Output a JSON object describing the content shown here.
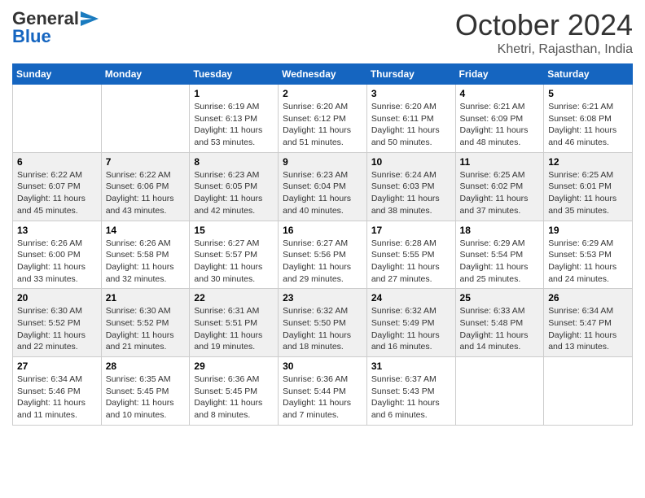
{
  "header": {
    "logo_general": "General",
    "logo_blue": "Blue",
    "month_title": "October 2024",
    "location": "Khetri, Rajasthan, India"
  },
  "weekdays": [
    "Sunday",
    "Monday",
    "Tuesday",
    "Wednesday",
    "Thursday",
    "Friday",
    "Saturday"
  ],
  "weeks": [
    [
      {
        "day": "",
        "info": ""
      },
      {
        "day": "",
        "info": ""
      },
      {
        "day": "1",
        "info": "Sunrise: 6:19 AM\nSunset: 6:13 PM\nDaylight: 11 hours and 53 minutes."
      },
      {
        "day": "2",
        "info": "Sunrise: 6:20 AM\nSunset: 6:12 PM\nDaylight: 11 hours and 51 minutes."
      },
      {
        "day": "3",
        "info": "Sunrise: 6:20 AM\nSunset: 6:11 PM\nDaylight: 11 hours and 50 minutes."
      },
      {
        "day": "4",
        "info": "Sunrise: 6:21 AM\nSunset: 6:09 PM\nDaylight: 11 hours and 48 minutes."
      },
      {
        "day": "5",
        "info": "Sunrise: 6:21 AM\nSunset: 6:08 PM\nDaylight: 11 hours and 46 minutes."
      }
    ],
    [
      {
        "day": "6",
        "info": "Sunrise: 6:22 AM\nSunset: 6:07 PM\nDaylight: 11 hours and 45 minutes."
      },
      {
        "day": "7",
        "info": "Sunrise: 6:22 AM\nSunset: 6:06 PM\nDaylight: 11 hours and 43 minutes."
      },
      {
        "day": "8",
        "info": "Sunrise: 6:23 AM\nSunset: 6:05 PM\nDaylight: 11 hours and 42 minutes."
      },
      {
        "day": "9",
        "info": "Sunrise: 6:23 AM\nSunset: 6:04 PM\nDaylight: 11 hours and 40 minutes."
      },
      {
        "day": "10",
        "info": "Sunrise: 6:24 AM\nSunset: 6:03 PM\nDaylight: 11 hours and 38 minutes."
      },
      {
        "day": "11",
        "info": "Sunrise: 6:25 AM\nSunset: 6:02 PM\nDaylight: 11 hours and 37 minutes."
      },
      {
        "day": "12",
        "info": "Sunrise: 6:25 AM\nSunset: 6:01 PM\nDaylight: 11 hours and 35 minutes."
      }
    ],
    [
      {
        "day": "13",
        "info": "Sunrise: 6:26 AM\nSunset: 6:00 PM\nDaylight: 11 hours and 33 minutes."
      },
      {
        "day": "14",
        "info": "Sunrise: 6:26 AM\nSunset: 5:58 PM\nDaylight: 11 hours and 32 minutes."
      },
      {
        "day": "15",
        "info": "Sunrise: 6:27 AM\nSunset: 5:57 PM\nDaylight: 11 hours and 30 minutes."
      },
      {
        "day": "16",
        "info": "Sunrise: 6:27 AM\nSunset: 5:56 PM\nDaylight: 11 hours and 29 minutes."
      },
      {
        "day": "17",
        "info": "Sunrise: 6:28 AM\nSunset: 5:55 PM\nDaylight: 11 hours and 27 minutes."
      },
      {
        "day": "18",
        "info": "Sunrise: 6:29 AM\nSunset: 5:54 PM\nDaylight: 11 hours and 25 minutes."
      },
      {
        "day": "19",
        "info": "Sunrise: 6:29 AM\nSunset: 5:53 PM\nDaylight: 11 hours and 24 minutes."
      }
    ],
    [
      {
        "day": "20",
        "info": "Sunrise: 6:30 AM\nSunset: 5:52 PM\nDaylight: 11 hours and 22 minutes."
      },
      {
        "day": "21",
        "info": "Sunrise: 6:30 AM\nSunset: 5:52 PM\nDaylight: 11 hours and 21 minutes."
      },
      {
        "day": "22",
        "info": "Sunrise: 6:31 AM\nSunset: 5:51 PM\nDaylight: 11 hours and 19 minutes."
      },
      {
        "day": "23",
        "info": "Sunrise: 6:32 AM\nSunset: 5:50 PM\nDaylight: 11 hours and 18 minutes."
      },
      {
        "day": "24",
        "info": "Sunrise: 6:32 AM\nSunset: 5:49 PM\nDaylight: 11 hours and 16 minutes."
      },
      {
        "day": "25",
        "info": "Sunrise: 6:33 AM\nSunset: 5:48 PM\nDaylight: 11 hours and 14 minutes."
      },
      {
        "day": "26",
        "info": "Sunrise: 6:34 AM\nSunset: 5:47 PM\nDaylight: 11 hours and 13 minutes."
      }
    ],
    [
      {
        "day": "27",
        "info": "Sunrise: 6:34 AM\nSunset: 5:46 PM\nDaylight: 11 hours and 11 minutes."
      },
      {
        "day": "28",
        "info": "Sunrise: 6:35 AM\nSunset: 5:45 PM\nDaylight: 11 hours and 10 minutes."
      },
      {
        "day": "29",
        "info": "Sunrise: 6:36 AM\nSunset: 5:45 PM\nDaylight: 11 hours and 8 minutes."
      },
      {
        "day": "30",
        "info": "Sunrise: 6:36 AM\nSunset: 5:44 PM\nDaylight: 11 hours and 7 minutes."
      },
      {
        "day": "31",
        "info": "Sunrise: 6:37 AM\nSunset: 5:43 PM\nDaylight: 11 hours and 6 minutes."
      },
      {
        "day": "",
        "info": ""
      },
      {
        "day": "",
        "info": ""
      }
    ]
  ],
  "row_classes": [
    "row-odd",
    "row-even",
    "row-odd",
    "row-even",
    "row-odd"
  ]
}
